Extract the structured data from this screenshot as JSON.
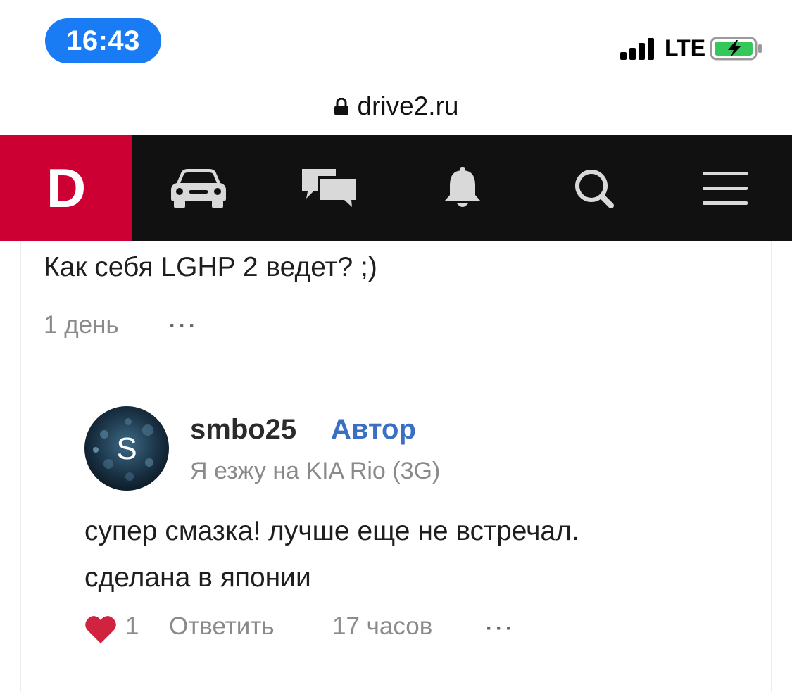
{
  "status_bar": {
    "time": "16:43",
    "carrier": "LTE",
    "battery_color": "#34c759",
    "time_pill_color": "#1a7cf5"
  },
  "browser": {
    "url": "drive2.ru"
  },
  "navbar": {
    "logo": "D",
    "logo_color": "#cc0033",
    "items": [
      {
        "icon": "car-icon"
      },
      {
        "icon": "chat-icon"
      },
      {
        "icon": "bell-icon"
      },
      {
        "icon": "search-icon"
      },
      {
        "icon": "menu-icon"
      }
    ]
  },
  "comment": {
    "text": "Как себя LGHP 2 ведет? ;)",
    "time": "1 день",
    "more": "···"
  },
  "reply": {
    "author": "smbo25",
    "badge": "Автор",
    "avatar_letter": "S",
    "car": "Я езжу на KIA Rio (3G)",
    "text_lines": [
      "супер смазка! лучше еще не встречал.",
      "сделана в японии"
    ],
    "likes": "1",
    "reply_label": "Ответить",
    "time": "17 часов",
    "more": "···",
    "heart_color": "#d0233f"
  }
}
